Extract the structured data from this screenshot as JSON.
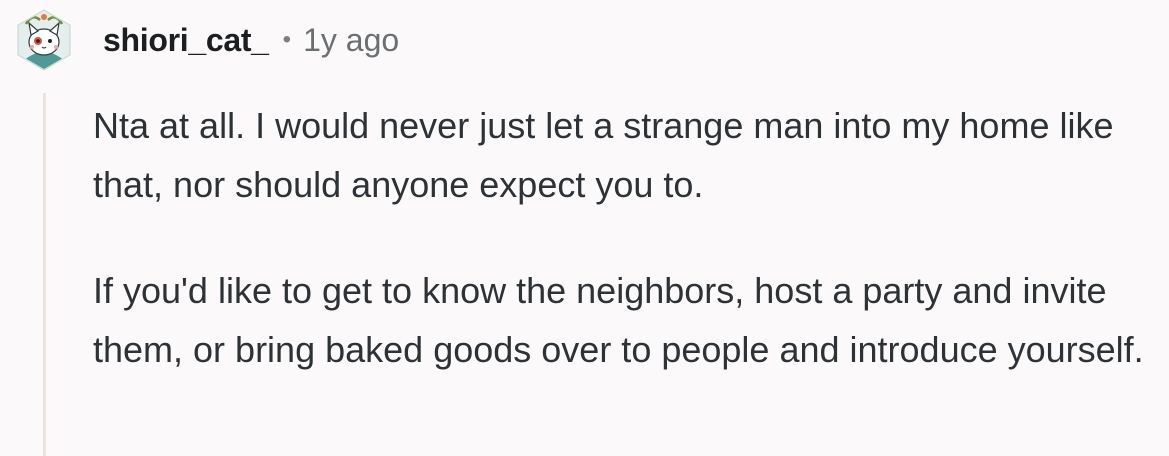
{
  "comment": {
    "username": "shiori_cat_",
    "separator": "•",
    "timestamp": "1y ago",
    "avatar_icon": "cat-avatar-icon",
    "paragraphs": [
      "Nta at all. I would never just let a strange man into my home like that, nor should anyone expect you to.",
      "If you'd like to get to know the neighbors, host a party and invite them, or bring baked goods over to people and introduce yourself."
    ]
  },
  "colors": {
    "background": "#fbf9f9",
    "username": "#1c1f22",
    "meta": "#6b6f72",
    "body_text": "#2c3236",
    "thread_line": "#ece3e1",
    "avatar_teal": "#4f9a96"
  }
}
